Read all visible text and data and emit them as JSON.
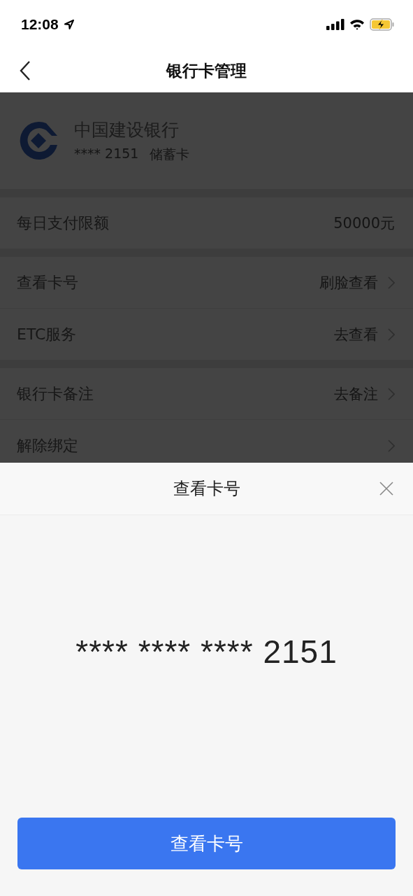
{
  "status_bar": {
    "time": "12:08"
  },
  "nav": {
    "title": "银行卡管理"
  },
  "card": {
    "bank": "中国建设银行",
    "number": "**** 2151",
    "type": "储蓄卡"
  },
  "groups": [
    {
      "rows": [
        {
          "kind": "info",
          "label": "每日支付限额",
          "value": "50000元"
        }
      ]
    },
    {
      "rows": [
        {
          "kind": "link",
          "label": "查看卡号",
          "value": "刷脸查看"
        },
        {
          "kind": "link",
          "label": "ETC服务",
          "value": "去查看"
        }
      ]
    },
    {
      "rows": [
        {
          "kind": "link",
          "label": "银行卡备注",
          "value": "去备注"
        },
        {
          "kind": "link",
          "label": "解除绑定"
        }
      ]
    }
  ],
  "sheet": {
    "title": "查看卡号",
    "card_number": "**** **** **** 2151",
    "button": "查看卡号"
  }
}
